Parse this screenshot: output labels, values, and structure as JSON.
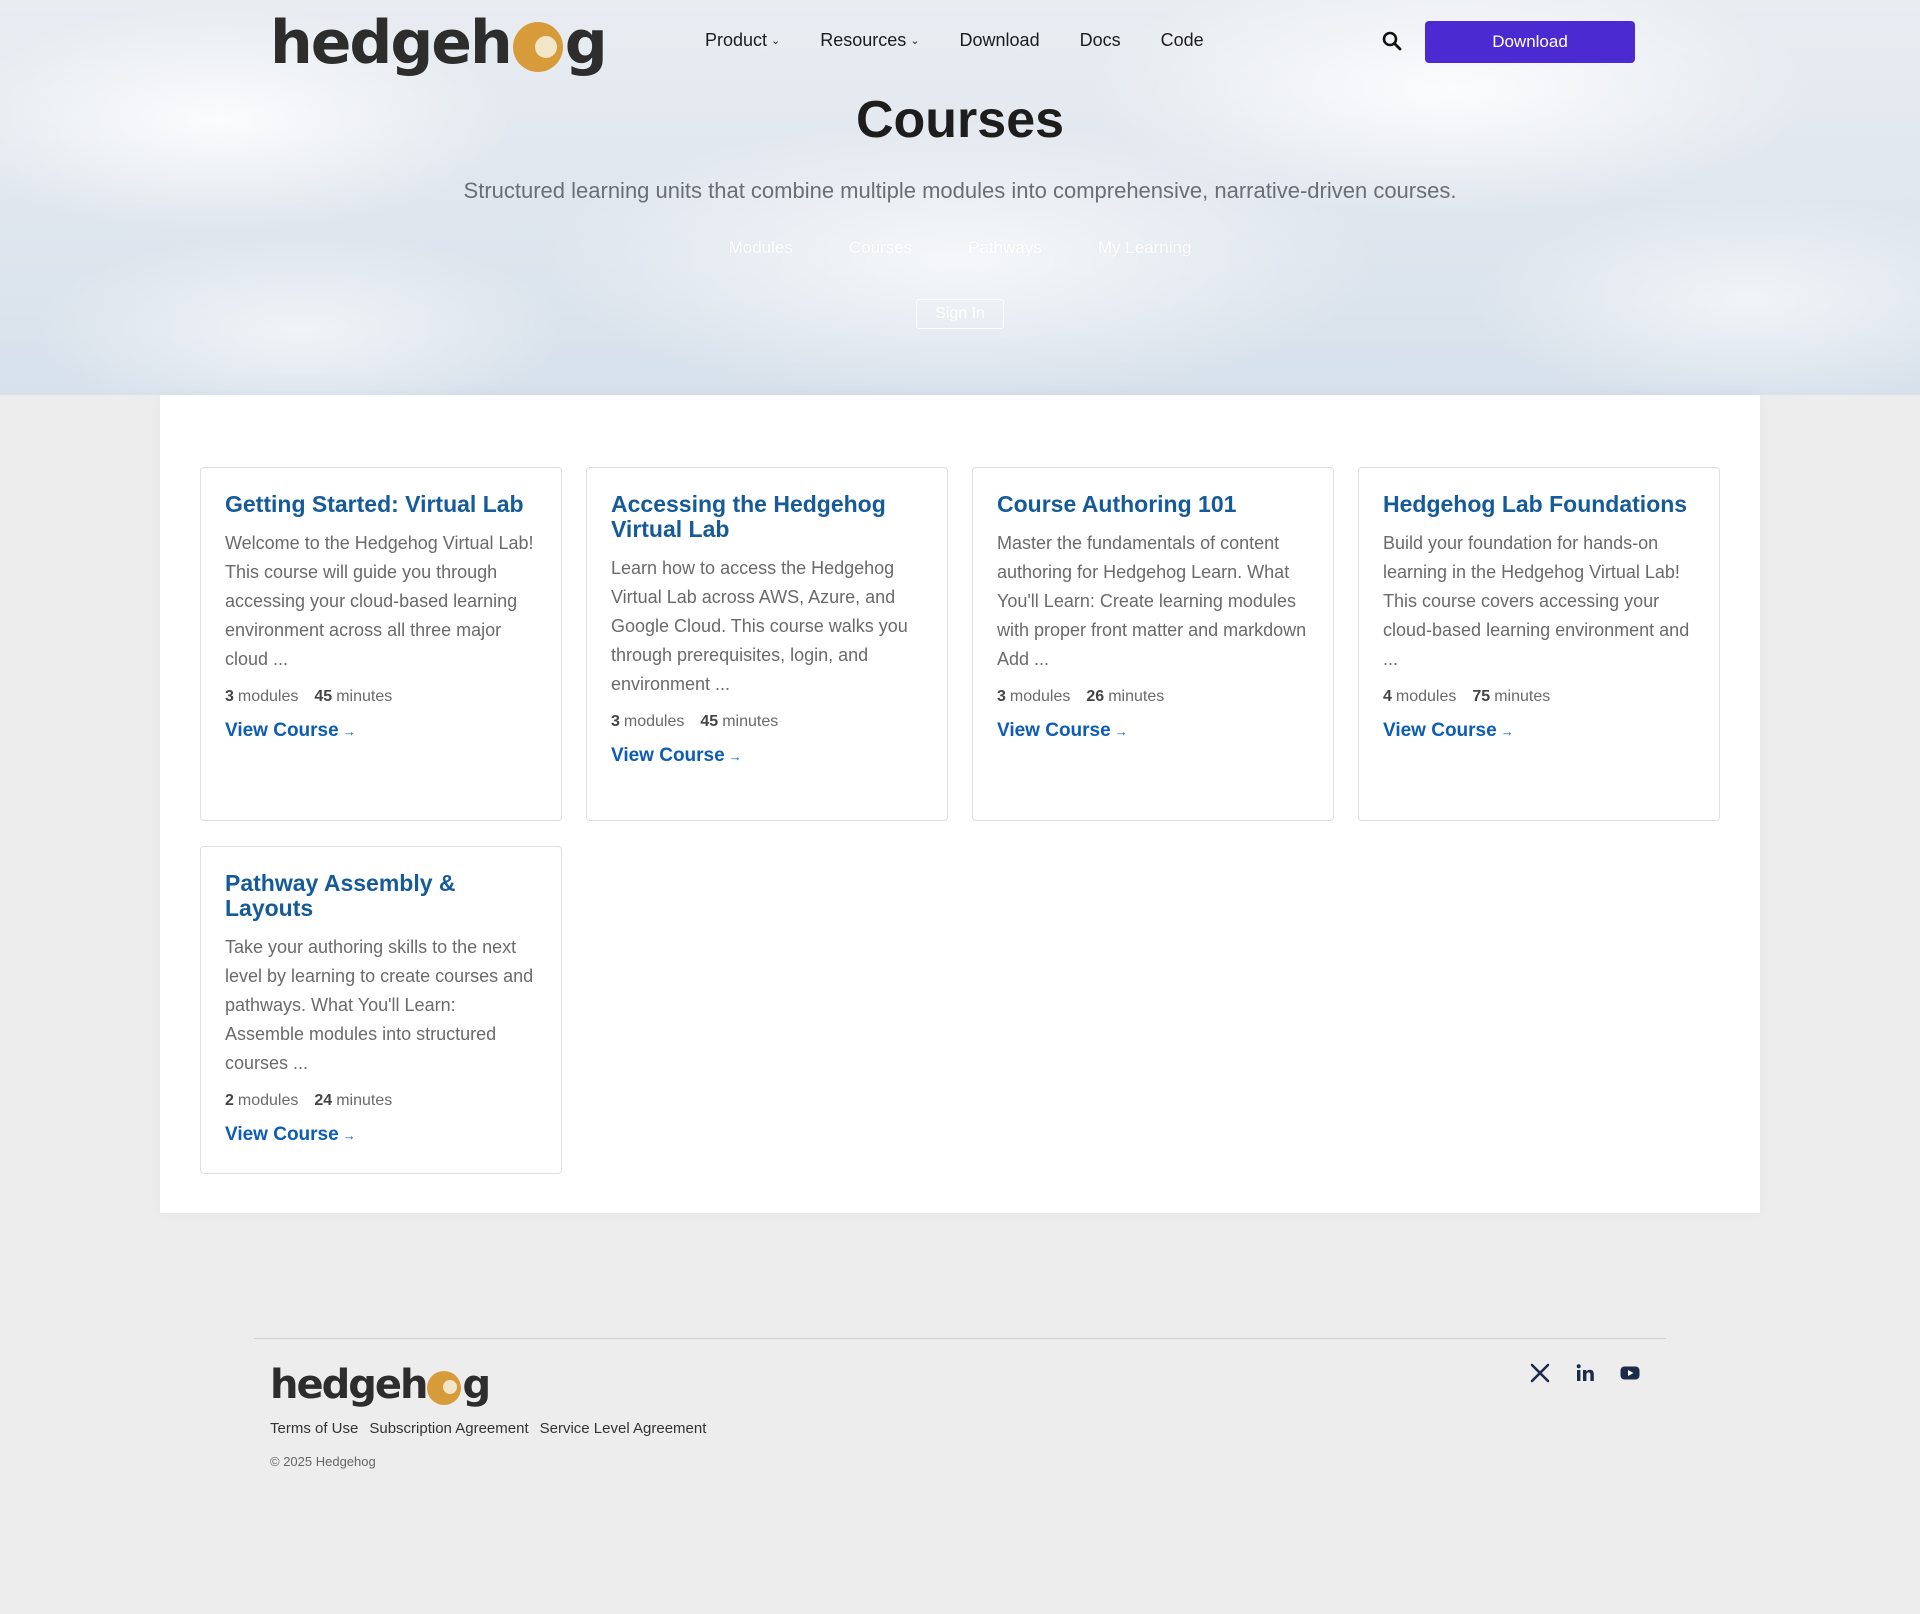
{
  "brand": {
    "logo_text_left": "hedgeh",
    "logo_text_right": "g"
  },
  "header": {
    "nav": [
      {
        "label": "Product",
        "has_dropdown": true
      },
      {
        "label": "Resources",
        "has_dropdown": true
      },
      {
        "label": "Download",
        "has_dropdown": false
      },
      {
        "label": "Docs",
        "has_dropdown": false
      },
      {
        "label": "Code",
        "has_dropdown": false
      }
    ],
    "dropdown_glyph": "⌄",
    "search_icon": "search-icon",
    "download_button": "Download",
    "accent_color": "#4b2ad1"
  },
  "hero": {
    "title": "Courses",
    "subtitle": "Structured learning units that combine multiple modules into comprehensive, narrative-driven courses.",
    "subnav": [
      "Modules",
      "Courses",
      "Pathways",
      "My Learning"
    ],
    "signin": "Sign In"
  },
  "courses": [
    {
      "title": "Getting Started: Virtual Lab",
      "description": "Welcome to the Hedgehog Virtual Lab! This course will guide you through accessing your cloud-based learning environment across all three major cloud ...",
      "modules": "3",
      "modules_label": "modules",
      "minutes": "45",
      "minutes_label": "minutes",
      "link": "View Course",
      "arrow": "→"
    },
    {
      "title": "Accessing the Hedgehog Virtual Lab",
      "description": "Learn how to access the Hedgehog Virtual Lab across AWS, Azure, and Google Cloud. This course walks you through prerequisites, login, and environment ...",
      "modules": "3",
      "modules_label": "modules",
      "minutes": "45",
      "minutes_label": "minutes",
      "link": "View Course",
      "arrow": "→"
    },
    {
      "title": "Course Authoring 101",
      "description": "Master the fundamentals of content authoring for Hedgehog Learn. What You'll Learn: Create learning modules with proper front matter and markdown Add ...",
      "modules": "3",
      "modules_label": "modules",
      "minutes": "26",
      "minutes_label": "minutes",
      "link": "View Course",
      "arrow": "→"
    },
    {
      "title": "Hedgehog Lab Foundations",
      "description": "Build your foundation for hands-on learning in the Hedgehog Virtual Lab! This course covers accessing your cloud-based learning environment and ...",
      "modules": "4",
      "modules_label": "modules",
      "minutes": "75",
      "minutes_label": "minutes",
      "link": "View Course",
      "arrow": "→"
    },
    {
      "title": "Pathway Assembly & Layouts",
      "description": "Take your authoring skills to the next level by learning to create courses and pathways. What You'll Learn: Assemble modules into structured courses ...",
      "modules": "2",
      "modules_label": "modules",
      "minutes": "24",
      "minutes_label": "minutes",
      "link": "View Course",
      "arrow": "→"
    }
  ],
  "footer": {
    "links": [
      "Terms of Use",
      "Subscription Agreement",
      "Service Level Agreement"
    ],
    "copyright": "© 2025 Hedgehog",
    "social_icons": [
      "x-icon",
      "linkedin-icon",
      "youtube-icon"
    ]
  },
  "colors": {
    "title_blue": "#155a99",
    "link_blue": "#0d5cb5",
    "footer_bg": "#ededed"
  }
}
